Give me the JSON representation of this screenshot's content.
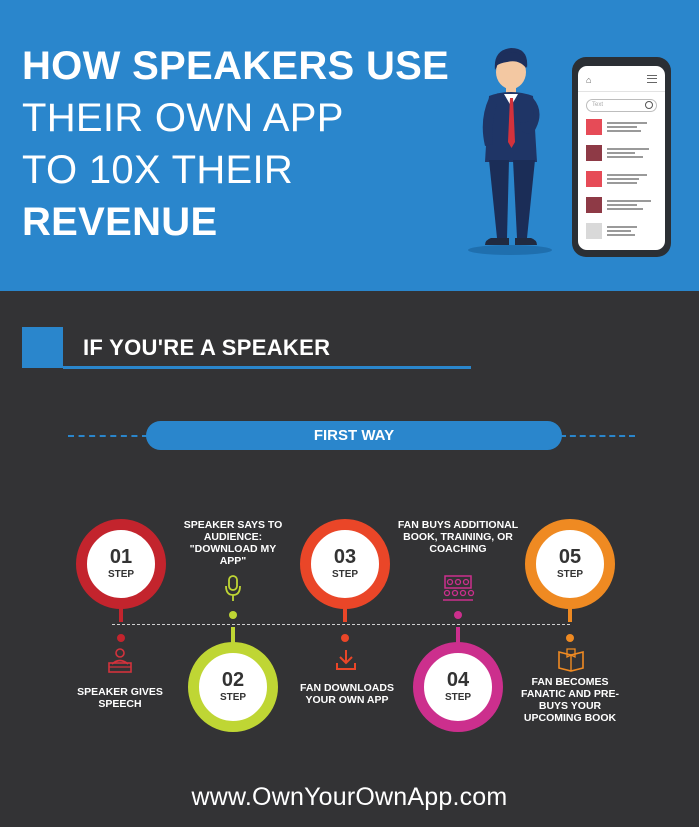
{
  "hero": {
    "title_line1": "HOW SPEAKERS USE",
    "title_line2": "THEIR OWN APP",
    "title_line3": "TO 10X THEIR",
    "title_line4": "REVENUE",
    "background_color": "#2a86cc",
    "phone": {
      "search_placeholder": "Text",
      "rows": [
        {
          "color": "#e64b57"
        },
        {
          "color": "#8e3a46"
        },
        {
          "color": "#e64b57"
        },
        {
          "color": "#8e3a46"
        },
        {
          "color": "#d9d9d9"
        }
      ]
    }
  },
  "section": {
    "title": "IF YOU'RE A SPEAKER"
  },
  "way": {
    "label": "FIRST WAY"
  },
  "steps": [
    {
      "num": "01",
      "label": "STEP",
      "color": "#c3242d",
      "caption": "SPEAKER GIVES SPEECH",
      "icon": "speaker-podium-icon"
    },
    {
      "num": "02",
      "label": "STEP",
      "color": "#bfd634",
      "caption": "SPEAKER SAYS TO AUDIENCE: \"DOWNLOAD MY APP\"",
      "icon": "microphone-icon"
    },
    {
      "num": "03",
      "label": "STEP",
      "color": "#ea4628",
      "caption": "FAN DOWNLOADS YOUR OWN APP",
      "icon": "download-icon"
    },
    {
      "num": "04",
      "label": "STEP",
      "color": "#cc2f8d",
      "caption": "FAN BUYS ADDITIONAL BOOK, TRAINING, OR COACHING",
      "icon": "audience-icon"
    },
    {
      "num": "05",
      "label": "STEP",
      "color": "#ef8a22",
      "caption": "FAN BECOMES FANATIC AND PRE-BUYS YOUR UPCOMING BOOK",
      "icon": "book-icon"
    }
  ],
  "footer": {
    "url": "www.OwnYourOwnApp.com"
  }
}
